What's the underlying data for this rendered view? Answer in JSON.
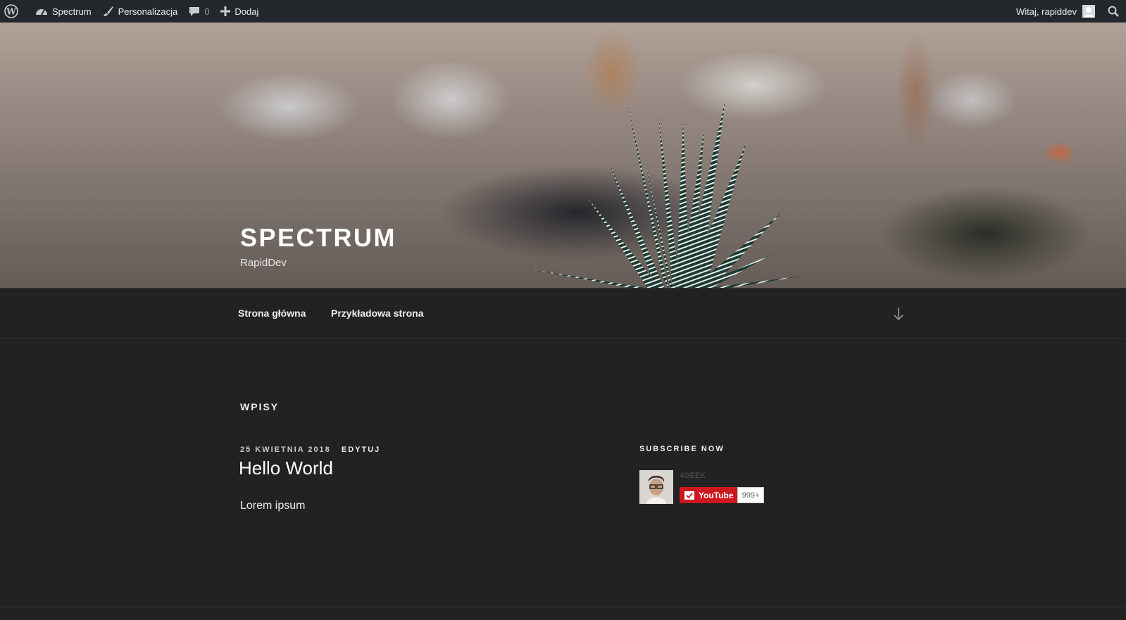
{
  "adminbar": {
    "wp_logo_icon": "wordpress-icon",
    "site_name": "Spectrum",
    "customize": "Personalizacja",
    "comments_count": "0",
    "new_label": "Dodaj",
    "greeting": "Witaj, rapiddev"
  },
  "header": {
    "title": "SPECTRUM",
    "description": "RapidDev"
  },
  "nav": {
    "items": [
      {
        "label": "Strona główna"
      },
      {
        "label": "Przykładowa strona"
      }
    ]
  },
  "main": {
    "section_title": "WPISY",
    "post": {
      "date": "25 KWIETNIA 2018",
      "edit_label": "EDYTUJ",
      "title": "Hello World",
      "excerpt": "Lorem ipsum"
    }
  },
  "sidebar": {
    "widget_title": "SUBSCRIBE NOW",
    "youtube": {
      "channel": "4GEEK",
      "button_label": "YouTube",
      "count": "999+"
    }
  },
  "colors": {
    "adminbar_bg": "#23282d",
    "page_bg": "#222222",
    "youtube_red": "#cc181e"
  }
}
